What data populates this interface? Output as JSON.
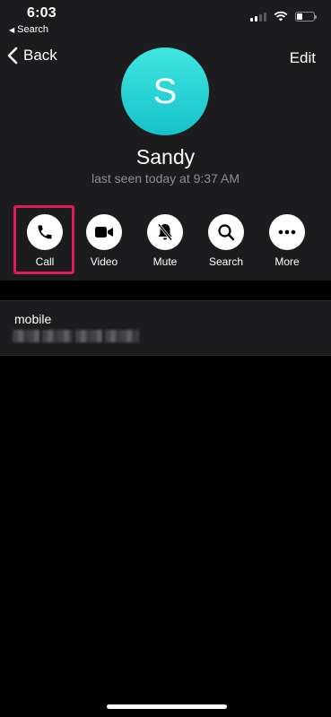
{
  "status_bar": {
    "time": "6:03",
    "back_app": "Search",
    "signal_bars_filled": 2,
    "signal_bars_total": 4,
    "battery_level": 0.3
  },
  "nav": {
    "back_label": "Back",
    "edit_label": "Edit"
  },
  "contact": {
    "avatar_letter": "S",
    "name": "Sandy",
    "last_seen": "last seen today at 9:37 AM",
    "avatar_color": "#22cfd4"
  },
  "actions": [
    {
      "label": "Call",
      "icon": "phone-icon",
      "highlighted": true
    },
    {
      "label": "Video",
      "icon": "video-icon"
    },
    {
      "label": "Mute",
      "icon": "bell-slash-icon"
    },
    {
      "label": "Search",
      "icon": "search-icon"
    },
    {
      "label": "More",
      "icon": "more-icon"
    }
  ],
  "info": {
    "phone_label": "mobile",
    "phone_value_redacted": true
  },
  "colors": {
    "highlight": "#e2195a",
    "background": "#000000",
    "panel": "#1c1c1e",
    "secondary_text": "#8e8e93"
  }
}
